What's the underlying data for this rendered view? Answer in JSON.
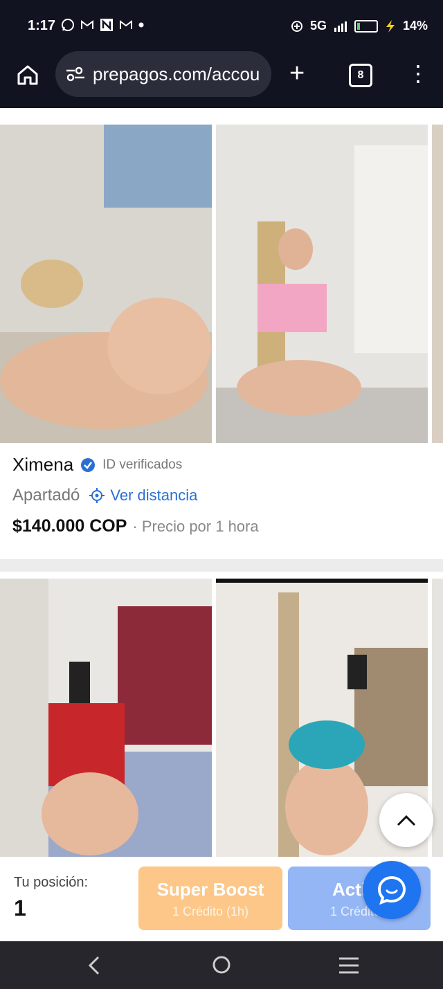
{
  "status_bar": {
    "time": "1:17",
    "notification_icons": [
      "whatsapp-icon",
      "gmail-icon",
      "news-icon",
      "gmail-icon",
      "dot-icon"
    ],
    "network": "5G",
    "battery_percent": "14%"
  },
  "browser": {
    "url": "prepagos.com/accou",
    "tab_count": "8"
  },
  "listings": [
    {
      "name": "Ximena",
      "verified_label": "ID verificados",
      "city": "Apartadó",
      "distance_link": "Ver distancia",
      "price": "$140.000 COP",
      "price_note": "· Precio por 1 hora"
    }
  ],
  "bottom_panel": {
    "position_label": "Tu posición:",
    "position_value": "1",
    "boost_button": {
      "title": "Super Boost",
      "subtitle": "1 Crédito (1h)"
    },
    "activate_button": {
      "title": "Activa",
      "subtitle": "1 Crédito ("
    }
  },
  "colors": {
    "accent": "#2a6fd4",
    "boost": "#fcc788",
    "activate": "#94b6f5",
    "chat": "#1f74f0"
  }
}
